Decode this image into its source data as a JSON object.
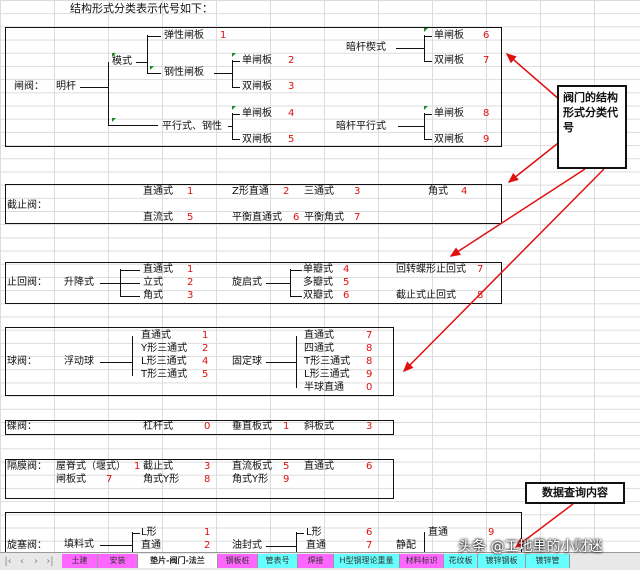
{
  "heading": "结构形式分类表示代号如下：",
  "gate": {
    "label": "闸阀：",
    "mingan": "明杆",
    "wedge": "模式",
    "elastic": "弹性闸板",
    "elastic_code": "1",
    "rigid": "钢性闸板",
    "single": "单闸板",
    "single_code": "2",
    "double": "双闸板",
    "double_code": "3",
    "parallel": "平行式、钢性",
    "p_single": "单闸板",
    "p_single_code": "4",
    "p_double": "双闸板",
    "p_double_code": "5",
    "angan_wedge": "暗杆楔式",
    "a_single": "单闸板",
    "a_single_code": "6",
    "a_double": "双闸板",
    "a_double_code": "7",
    "angan_parallel": "暗杆平行式",
    "ap_single": "单闸板",
    "ap_single_code": "8",
    "ap_double": "双闸板",
    "ap_double_code": "9"
  },
  "globe": {
    "label": "截止阀：",
    "items": [
      {
        "name": "直通式",
        "code": "1"
      },
      {
        "name": "Z形直通",
        "code": "2"
      },
      {
        "name": "三通式",
        "code": "3"
      },
      {
        "name": "角式",
        "code": "4"
      },
      {
        "name": "直流式",
        "code": "5"
      },
      {
        "name": "平衡直通式",
        "code": "6"
      },
      {
        "name": "平衡角式",
        "code": "7"
      }
    ]
  },
  "check": {
    "label": "止回阀：",
    "lift": "升降式",
    "lift_items": [
      {
        "name": "直通式",
        "code": "1"
      },
      {
        "name": "立式",
        "code": "2"
      },
      {
        "name": "角式",
        "code": "3"
      }
    ],
    "swing": "旋启式",
    "swing_items": [
      {
        "name": "单瓣式",
        "code": "4"
      },
      {
        "name": "多瓣式",
        "code": "5"
      },
      {
        "name": "双瓣式",
        "code": "6"
      }
    ],
    "butterfly": "回转蝶形止回式",
    "butterfly_code": "7",
    "stopcheck": "截止式止回式",
    "stopcheck_code": "8"
  },
  "ball": {
    "label": "球阀：",
    "floating": "浮动球",
    "float_items": [
      {
        "name": "直通式",
        "code": "1"
      },
      {
        "name": "Y形三通式",
        "code": "2"
      },
      {
        "name": "L形三通式",
        "code": "4"
      },
      {
        "name": "T形三通式",
        "code": "5"
      }
    ],
    "fixed": "固定球",
    "fixed_items": [
      {
        "name": "直通式",
        "code": "7"
      },
      {
        "name": "四通式",
        "code": "8"
      },
      {
        "name": "T形三通式",
        "code": "8"
      },
      {
        "name": "L形三通式",
        "code": "9"
      },
      {
        "name": "半球直通",
        "code": "0"
      }
    ]
  },
  "butterfly": {
    "label": "碟阀：",
    "items": [
      {
        "name": "杠杆式",
        "code": "0"
      },
      {
        "name": "垂直板式",
        "code": "1"
      },
      {
        "name": "斜板式",
        "code": "3"
      }
    ]
  },
  "diaphragm": {
    "label": "隔膜阀：",
    "items": [
      {
        "name": "屋脊式（堰式）",
        "code": "1"
      },
      {
        "name": "截止式",
        "code": "3"
      },
      {
        "name": "直流板式",
        "code": "5"
      },
      {
        "name": "直通式",
        "code": "6"
      },
      {
        "name": "闸板式",
        "code": "7"
      },
      {
        "name": "角式Y形",
        "code": "8"
      },
      {
        "name": "角式Y形",
        "code": "9"
      }
    ]
  },
  "plug": {
    "label": "旋塞阀：",
    "packed": "填料式",
    "packed_items": [
      {
        "name": "L形",
        "code": "1"
      },
      {
        "name": "直通",
        "code": "2"
      }
    ],
    "oil": "油封式",
    "oil_items": [
      {
        "name": "L形",
        "code": "6"
      },
      {
        "name": "直通",
        "code": "7"
      }
    ],
    "static": "静配",
    "static_items": [
      {
        "name": "直通",
        "code": "9"
      }
    ]
  },
  "callout": "阀门的结构形式分类代号",
  "callout2": "数据查询内容",
  "watermark": "头条 @工地里的小财迷",
  "tabs": [
    {
      "label": "土建",
      "color": "#ff66ff"
    },
    {
      "label": "安装",
      "color": "#ff66ff"
    },
    {
      "label": "垫片-阀门-法兰",
      "color": "#ffffff",
      "active": true
    },
    {
      "label": "钢板桩",
      "color": "#ff66ff"
    },
    {
      "label": "管表号",
      "color": "#66ffff"
    },
    {
      "label": "焊接",
      "color": "#ff66ff"
    },
    {
      "label": "H型钢理论重量",
      "color": "#66ffff"
    },
    {
      "label": "材料标识",
      "color": "#ff66ff"
    },
    {
      "label": "花纹板",
      "color": "#66ffff"
    },
    {
      "label": "镀锌钢板",
      "color": "#66ffff"
    },
    {
      "label": "镀锌管",
      "color": "#66ffff"
    }
  ],
  "colors": {
    "code_red": "#e01010",
    "arrow": "#e01010",
    "grid": "#dcdcdc",
    "tab_magenta": "#ff66ff",
    "tab_cyan": "#66ffff"
  }
}
